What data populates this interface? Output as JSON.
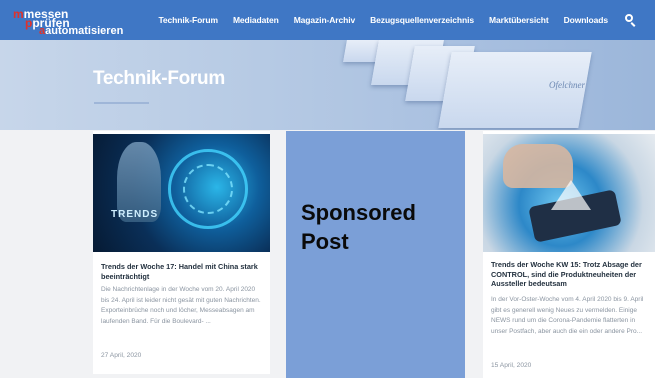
{
  "logo": {
    "line1": "messen",
    "line2": "prüfen",
    "line3": "automatisieren"
  },
  "nav": {
    "items": [
      "Technik-Forum",
      "Mediadaten",
      "Magazin-Archiv",
      "Bezugsquellenverzeichnis",
      "Marktübersicht",
      "Downloads"
    ],
    "search_icon": "search-icon"
  },
  "hero": {
    "title": "Technik-Forum",
    "brand_text": "Ofelchner"
  },
  "cards": [
    {
      "image_text": "TRENDS",
      "title": "Trends der Woche 17: Handel mit China stark beeinträchtigt",
      "excerpt": "Die Nachrichtenlage in der Woche vom 20. April 2020 bis 24. April ist leider nicht gesät mit guten Nachrichten. Exporteinbrüche noch und löcher, Messeabsagen am laufenden Band. Für die Boulevard- ...",
      "date": "27 April, 2020"
    },
    {
      "title": "Trends der Woche KW 15: Trotz Absage der CONTROL, sind die Produktneuheiten der Aussteller bedeutsam",
      "excerpt": "In der Vor-Oster-Woche vom 4. April 2020 bis 9. April gibt es generell wenig Neues zu vermelden. Einige NEWS rund um die Corona-Pandemie flatterten in unser Postfach, aber auch die ein oder andere Pro...",
      "date": "15 April, 2020"
    }
  ],
  "sponsored": {
    "label": "Sponsored Post"
  },
  "colors": {
    "nav_bg": "#3f77c5",
    "accent_red": "#e0322b",
    "sponsored_bg": "#7b9fd7"
  }
}
